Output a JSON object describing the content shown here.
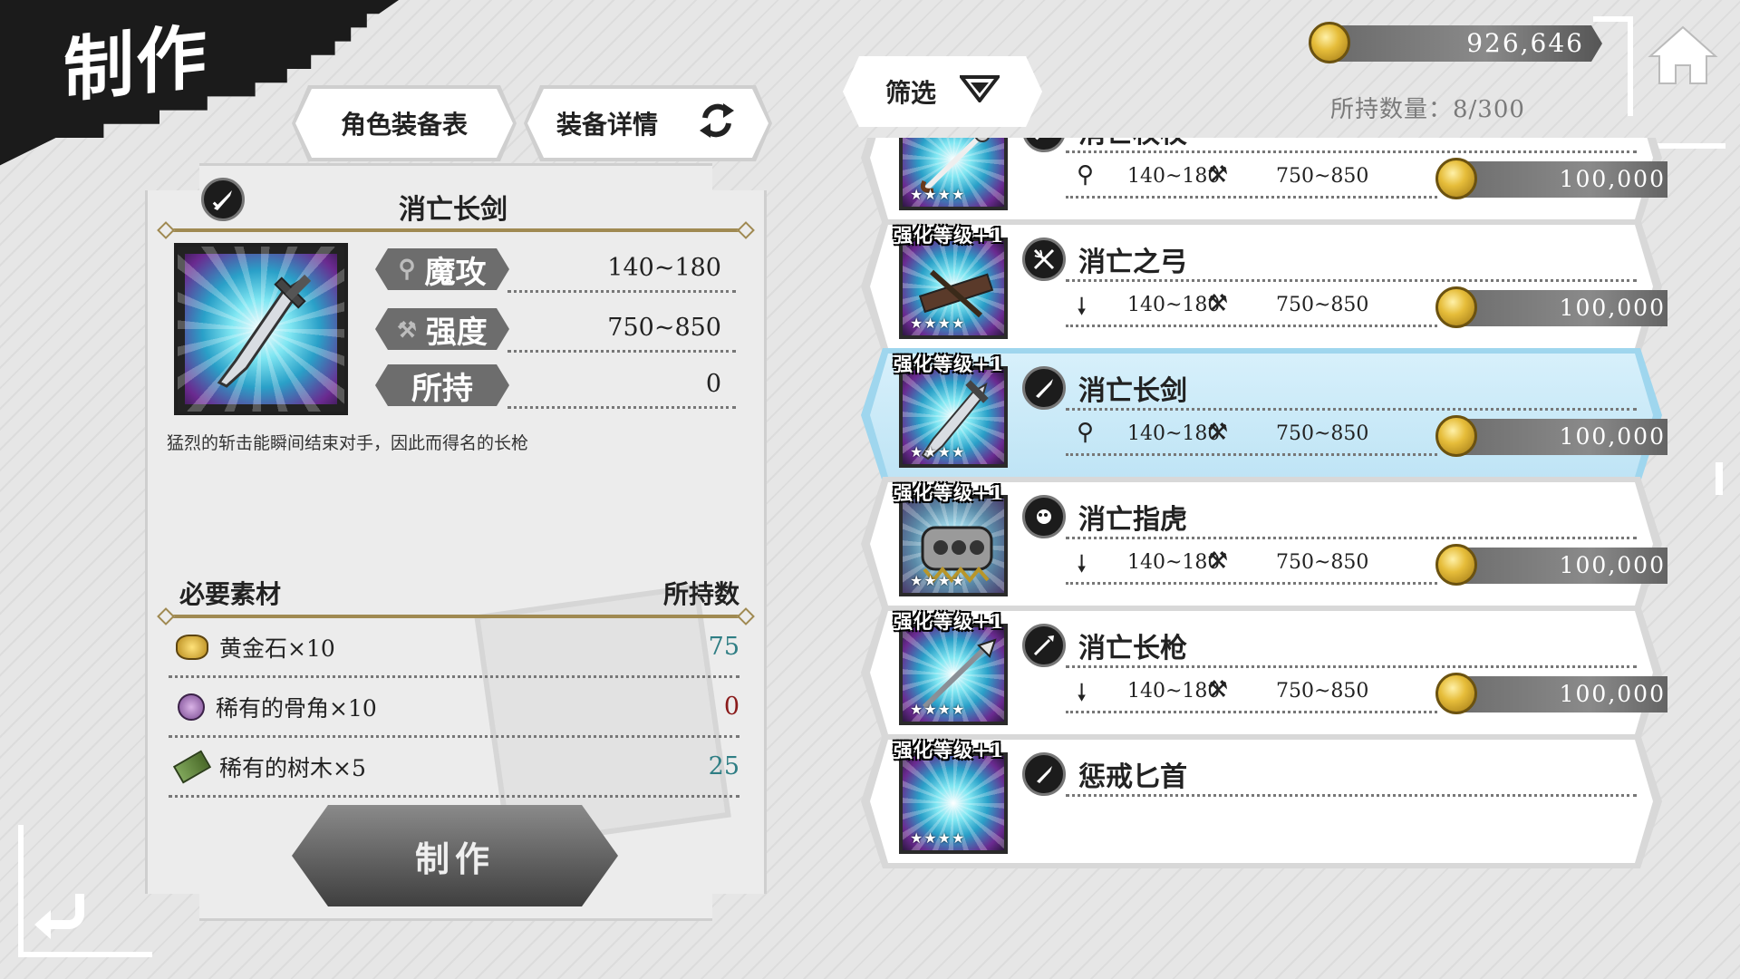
{
  "header": {
    "title": "制作"
  },
  "tabs": [
    {
      "label": "角色装备表"
    },
    {
      "label": "装备详情"
    }
  ],
  "detail": {
    "name": "消亡长剑",
    "stats": [
      {
        "label": "魔攻",
        "icon": "magic-attack-icon",
        "value": "140~180"
      },
      {
        "label": "强度",
        "icon": "anvil-icon",
        "value": "750~850"
      },
      {
        "label": "所持",
        "icon": "",
        "value": "0"
      }
    ],
    "description": "猛烈的斩击能瞬间结束对手，因此而得名的长枪",
    "materials_header": "必要素材",
    "owned_header": "所持数",
    "materials": [
      {
        "name": "黄金石×10",
        "owned": "75",
        "color": "#2f7e84",
        "icon": "gold-ore-icon"
      },
      {
        "name": "稀有的骨角×10",
        "owned": "0",
        "color": "#8a1a1a",
        "icon": "bone-horn-icon"
      },
      {
        "name": "稀有的树木×5",
        "owned": "25",
        "color": "#2f7e84",
        "icon": "wood-icon"
      }
    ],
    "craft_label": "制作"
  },
  "filter": {
    "label": "筛选"
  },
  "currency": {
    "amount": "926,646"
  },
  "inventory": {
    "text": "所持数量：8/300"
  },
  "list": [
    {
      "name": "消亡权杖",
      "badge": "",
      "atk": "140~180",
      "str": "750~850",
      "price": "100,000",
      "icon": "staff-icon",
      "stat_icon": "magic-attack-icon",
      "selected": false
    },
    {
      "name": "消亡之弓",
      "badge": "强化等级+1",
      "atk": "140~180",
      "str": "750~850",
      "price": "100,000",
      "icon": "bow-icon",
      "stat_icon": "physical-attack-icon",
      "selected": false
    },
    {
      "name": "消亡长剑",
      "badge": "强化等级+1",
      "atk": "140~180",
      "str": "750~850",
      "price": "100,000",
      "icon": "sword-icon",
      "stat_icon": "magic-attack-icon",
      "selected": true
    },
    {
      "name": "消亡指虎",
      "badge": "强化等级+1",
      "atk": "140~180",
      "str": "750~850",
      "price": "100,000",
      "icon": "knuckle-icon",
      "stat_icon": "physical-attack-icon",
      "selected": false
    },
    {
      "name": "消亡长枪",
      "badge": "强化等级+1",
      "atk": "140~180",
      "str": "750~850",
      "price": "100,000",
      "icon": "spear-icon",
      "stat_icon": "physical-attack-icon",
      "selected": false
    },
    {
      "name": "惩戒匕首",
      "badge": "强化等级+1",
      "atk": "",
      "str": "",
      "price": "",
      "icon": "dagger-icon",
      "stat_icon": "",
      "selected": false
    }
  ],
  "stars": "★★★★",
  "colors": {
    "selected_bg": "#bfe4f5",
    "panel_bg": "#ececec",
    "gold": "#a08a52"
  }
}
